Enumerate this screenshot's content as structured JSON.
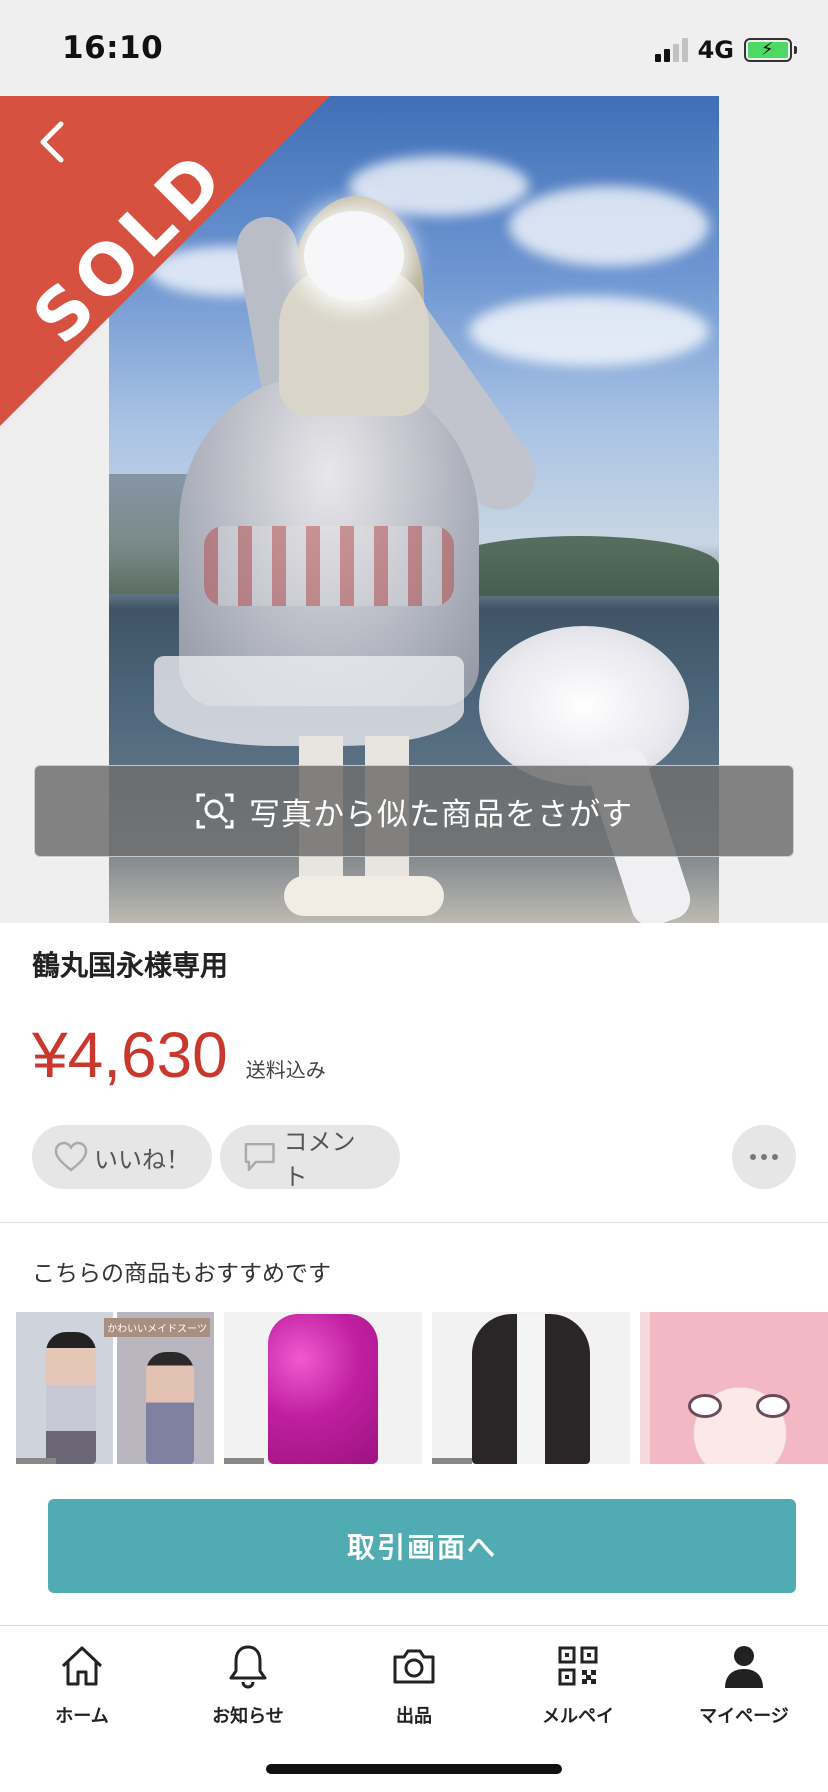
{
  "status_bar": {
    "time": "16:10",
    "network": "4G",
    "signal_bars_filled": 2,
    "battery_charging": true
  },
  "photo": {
    "sold_label": "SOLD",
    "similar_search_label": "写真から似た商品をさがす"
  },
  "item": {
    "title": "鶴丸国永様専用",
    "price": "¥4,630",
    "shipping": "送料込み"
  },
  "actions": {
    "like_label": "いいね！",
    "comment_label": "コメント"
  },
  "recommendations": {
    "title": "こちらの商品もおすすめです",
    "items": [
      {
        "tag": "かわいいメイドスーツ"
      },
      {
        "tag": ""
      },
      {
        "tag": ""
      },
      {
        "tag": ""
      }
    ]
  },
  "cta": {
    "label": "取引画面へ"
  },
  "tabbar": {
    "tabs": [
      {
        "label": "ホーム",
        "icon": "home-icon"
      },
      {
        "label": "お知らせ",
        "icon": "bell-icon"
      },
      {
        "label": "出品",
        "icon": "camera-icon"
      },
      {
        "label": "メルペイ",
        "icon": "qr-code-icon"
      },
      {
        "label": "マイページ",
        "icon": "user-icon"
      }
    ]
  },
  "colors": {
    "sold_banner": "#d75141",
    "price": "#c9382c",
    "cta": "#50abb2",
    "battery": "#4cd964"
  }
}
